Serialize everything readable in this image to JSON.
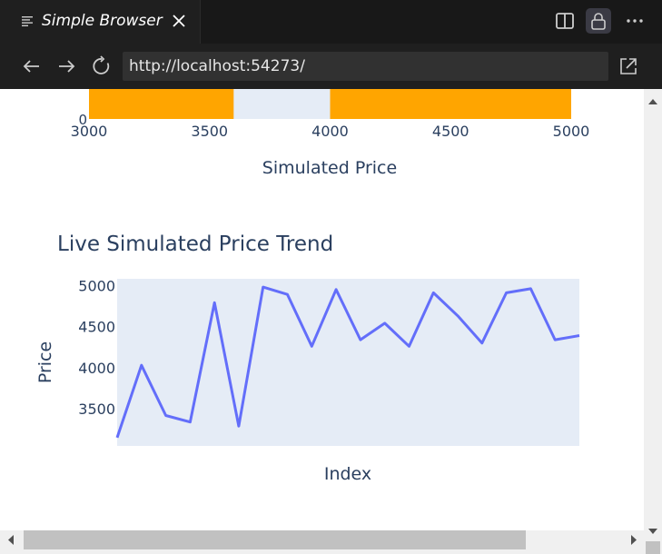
{
  "tab": {
    "title": "Simple Browser"
  },
  "address_bar": {
    "url": "http://localhost:54273/"
  },
  "histogram": {
    "xlabel": "Simulated Price",
    "y_visible_tick": "0",
    "x_ticks": [
      "3000",
      "3500",
      "4000",
      "4500",
      "5000"
    ],
    "bar_color": "#FFA500",
    "bars": [
      {
        "x0": 3000,
        "x1": 3600
      },
      {
        "x0": 4000,
        "x1": 5000
      }
    ]
  },
  "chart_data": {
    "type": "line",
    "title": "Live Simulated Price Trend",
    "xlabel": "Index",
    "ylabel": "Price",
    "yticks": [
      "3500",
      "4000",
      "4500",
      "5000"
    ],
    "ylim": [
      3050,
      5080
    ],
    "line_color": "#636EFA",
    "x": [
      0,
      1,
      2,
      3,
      4,
      5,
      6,
      7,
      8,
      9,
      10,
      11,
      12,
      13,
      14,
      15,
      16,
      17,
      18,
      19
    ],
    "values": [
      3150,
      4030,
      3420,
      3340,
      4790,
      3290,
      4980,
      4890,
      4260,
      4950,
      4340,
      4540,
      4260,
      4910,
      4630,
      4300,
      4910,
      4960,
      4340,
      4390
    ]
  },
  "colors": {
    "plot_bg": "#E5ECF6",
    "axis_text": "#2a3f5f"
  }
}
